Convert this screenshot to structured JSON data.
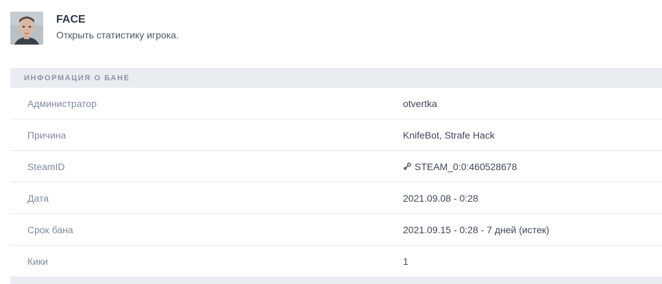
{
  "player": {
    "name": "FACE",
    "stats_link": "Открыть статистику игрока.",
    "avatar_icon": "player-avatar"
  },
  "ban_info": {
    "header": "ИНФОРМАЦИЯ О БАНЕ",
    "rows": [
      {
        "label": "Администратор",
        "value": "otvertka"
      },
      {
        "label": "Причина",
        "value": "KnifeBot, Strafe Hack"
      },
      {
        "label": "SteamID",
        "value": "STEAM_0:0:460528678",
        "icon": "steam-icon"
      },
      {
        "label": "Дата",
        "value": "2021.09.08 - 0:28"
      },
      {
        "label": "Срок бана",
        "value": "2021.09.15 - 0:28 - 7 дней (истек)"
      },
      {
        "label": "Кики",
        "value": "1"
      }
    ]
  },
  "colors": {
    "header_bg": "#e9ecf1",
    "label": "#7f8a9c",
    "value": "#3e4756",
    "title": "#2f3b4c"
  }
}
